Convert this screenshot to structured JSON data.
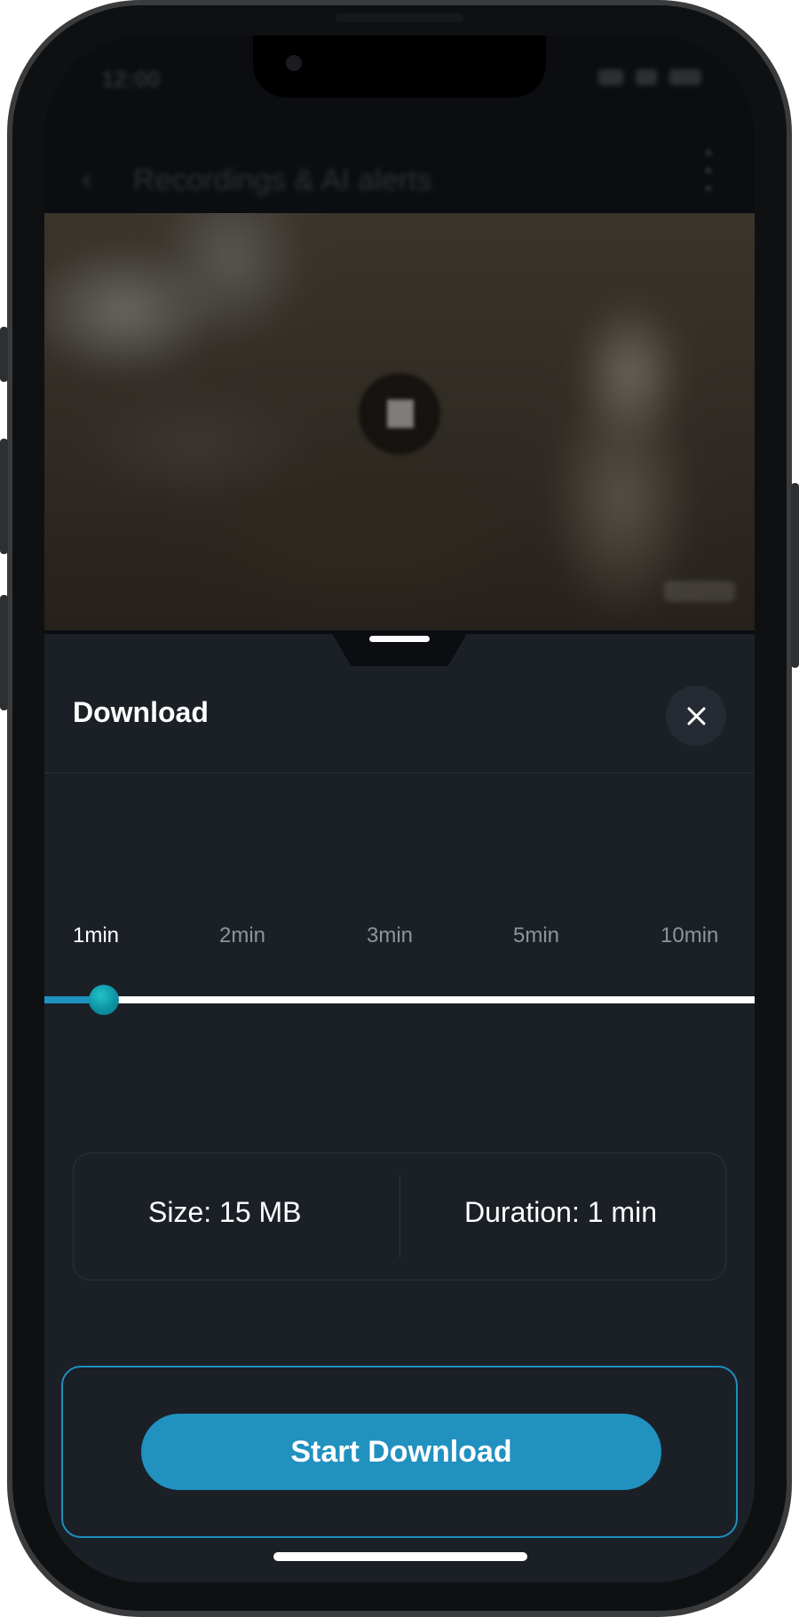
{
  "status_bar": {
    "time": "12:00"
  },
  "app_bar": {
    "title": "Recordings & AI alerts"
  },
  "sheet": {
    "title": "Download",
    "durations": [
      "1min",
      "2min",
      "3min",
      "5min",
      "10min"
    ],
    "selected_duration": "1min",
    "slider_value_fraction": 0.0,
    "info": {
      "size": "Size: 15 MB",
      "duration": "Duration: 1 min"
    },
    "start_label": "Start Download"
  },
  "colors": {
    "accent": "#2191c0",
    "sheet_background": "#1b2027",
    "slider_thumb": "#13a8b6"
  },
  "icons": {
    "close": "close-icon",
    "back": "chevron-left-icon",
    "more": "more-vertical-icon"
  }
}
